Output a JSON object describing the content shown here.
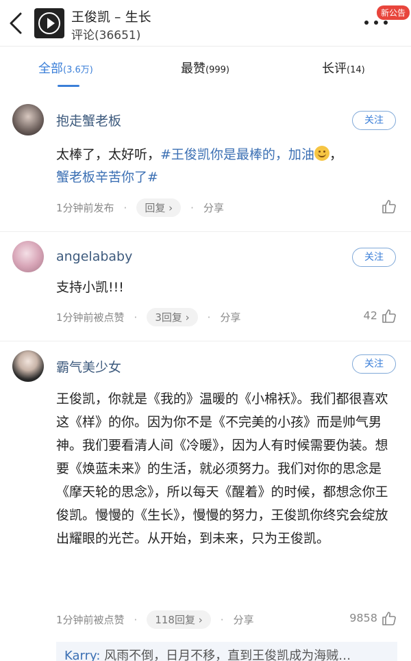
{
  "header": {
    "title": "王俊凯 – 生长",
    "subtitle": "评论(36651)",
    "badge": "新公告"
  },
  "tabs": [
    {
      "label": "全部",
      "count": "(3.6万)",
      "active": true
    },
    {
      "label": "最赞",
      "count": "(999)",
      "active": false
    },
    {
      "label": "长评",
      "count": "(14)",
      "active": false
    }
  ],
  "comments": [
    {
      "username": "抱走蟹老板",
      "follow": "关注",
      "text_a": "太棒了，太好听，",
      "text_tag": "#王俊凯你是最棒的，加油",
      "text_b": "，",
      "text_tag2": "蟹老板辛苦你了#",
      "time": "1分钟前发布",
      "reply": "回复 ›",
      "share": "分享",
      "likes": ""
    },
    {
      "username": "angelababy",
      "follow": "关注",
      "text": "支持小凯!!!",
      "time": "1分钟前被点赞",
      "reply": "3回复 ›",
      "share": "分享",
      "likes": "42"
    },
    {
      "username": "霸气美少女",
      "follow": "关注",
      "text": "王俊凯，你就是《我的》温暖的《小棉袄》。我们都很喜欢这《样》的你。因为你不是《不完美的小孩》而是帅气男神。我们要看清人间《冷暖》，因为人有时候需要伪装。想要《焕蓝未来》的生活，就必须努力。我们对你的思念是《摩天轮的思念》，所以每天《醒着》的时候，都想念你王俊凯。慢慢的《生长》，慢慢的努力，王俊凯你终究会绽放出耀眼的光芒。从开始，到未来，只为王俊凯。",
      "time": "1分钟前被点赞",
      "reply": "118回复 ›",
      "share": "分享",
      "likes": "9858",
      "quote_name": "Karry:",
      "quote_text": " 风雨不倒，日月不移，直到王俊凯成为海贼…"
    }
  ],
  "colors": {
    "accent": "#3b7fd8",
    "username": "#3d5a7d",
    "badge": "#e8453c"
  }
}
